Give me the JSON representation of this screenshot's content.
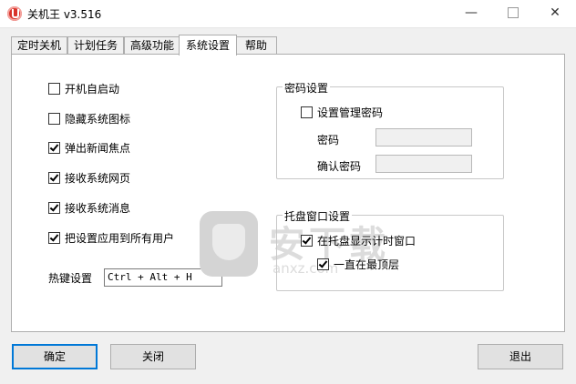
{
  "window": {
    "title": "关机王 v3.516",
    "minimize_glyph": "—",
    "close_glyph": "✕"
  },
  "tabs": [
    {
      "label": "定时关机",
      "active": false
    },
    {
      "label": "计划任务",
      "active": false
    },
    {
      "label": "高级功能",
      "active": false
    },
    {
      "label": "系统设置",
      "active": true
    },
    {
      "label": "帮助",
      "active": false
    }
  ],
  "settings": {
    "options": [
      {
        "label": "开机自启动",
        "checked": false
      },
      {
        "label": "隐藏系统图标",
        "checked": false
      },
      {
        "label": "弹出新闻焦点",
        "checked": true
      },
      {
        "label": "接收系统网页",
        "checked": true
      },
      {
        "label": "接收系统消息",
        "checked": true
      },
      {
        "label": "把设置应用到所有用户",
        "checked": true
      }
    ],
    "hotkey": {
      "label": "热键设置",
      "value": "Ctrl + Alt + H"
    }
  },
  "password_group": {
    "title": "密码设置",
    "set_admin_password": {
      "label": "设置管理密码",
      "checked": false
    },
    "password_label": "密码",
    "password_value": "",
    "confirm_label": "确认密码",
    "confirm_value": ""
  },
  "tray_group": {
    "title": "托盘窗口设置",
    "show_timer_window": {
      "label": "在托盘显示计时窗口",
      "checked": true
    },
    "always_on_top": {
      "label": "一直在最顶层",
      "checked": true
    }
  },
  "buttons": {
    "ok": "确定",
    "close": "关闭",
    "exit": "退出"
  },
  "watermark": {
    "text": "安下载",
    "subtext": "anxz.com"
  },
  "colors": {
    "accent": "#0078d7",
    "app_icon": "#d9342b"
  }
}
